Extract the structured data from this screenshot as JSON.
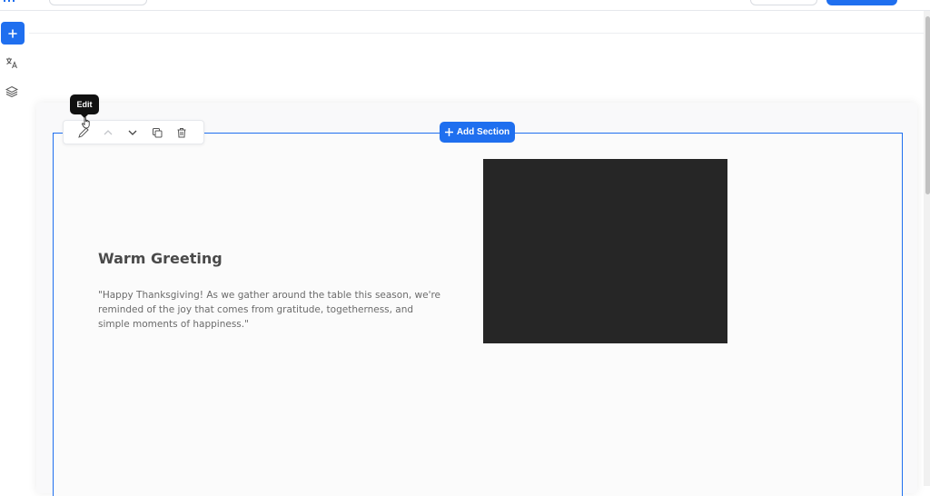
{
  "colors": {
    "accent": "#1f6fef",
    "image_placeholder": "#262626",
    "tooltip_bg": "#111111"
  },
  "sidebar": {
    "add_icon": "plus-icon",
    "icons": [
      "translate-icon",
      "layers-icon"
    ]
  },
  "toolbar": {
    "tooltip": "Edit",
    "icons": [
      "edit-pen-icon",
      "chevron-up-icon",
      "chevron-down-icon",
      "duplicate-icon",
      "trash-icon"
    ]
  },
  "add_section": {
    "label": "Add Section",
    "icon": "plus-icon"
  },
  "content": {
    "heading": "Warm Greeting",
    "paragraph": "\"Happy Thanksgiving! As we gather around the table this season, we're reminded of the joy that comes from gratitude, togetherness, and simple moments of happiness.\""
  }
}
